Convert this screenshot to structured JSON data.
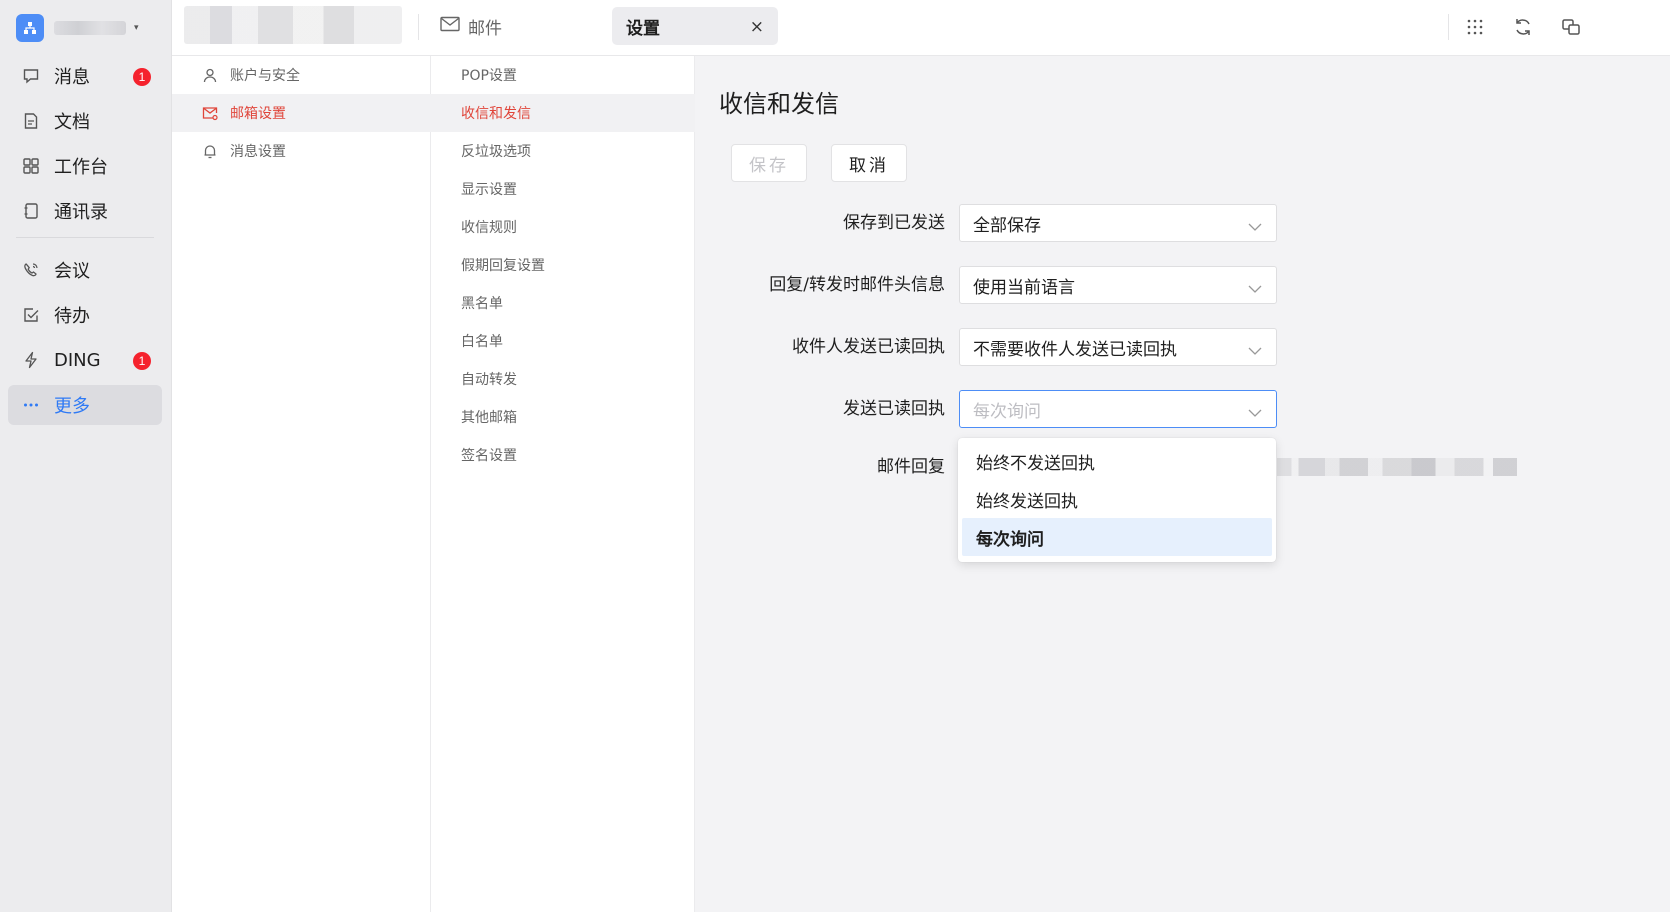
{
  "topbar": {
    "tabs": [
      {
        "label": "邮件",
        "icon": "mail-icon"
      },
      {
        "label": "设置",
        "icon": "",
        "active": true
      }
    ],
    "close_symbol": "×",
    "right_icons": [
      "apps-grid-icon",
      "refresh-icon",
      "window-switch-icon"
    ]
  },
  "sidebar": {
    "org_caret": "▾",
    "items": [
      {
        "label": "消息",
        "icon": "message-icon",
        "badge": "1"
      },
      {
        "label": "文档",
        "icon": "document-icon"
      },
      {
        "label": "工作台",
        "icon": "workbench-icon"
      },
      {
        "label": "通讯录",
        "icon": "contacts-icon"
      },
      {
        "label": "会议",
        "icon": "meeting-icon"
      },
      {
        "label": "待办",
        "icon": "todo-icon"
      },
      {
        "label": "DING",
        "icon": "ding-icon",
        "badge": "1"
      },
      {
        "label": "更多",
        "icon": "more-icon",
        "active": true
      }
    ]
  },
  "settings_categories": [
    {
      "label": "账户与安全",
      "icon": "user-icon"
    },
    {
      "label": "邮箱设置",
      "icon": "mail-settings-icon",
      "active": true
    },
    {
      "label": "消息设置",
      "icon": "bell-icon"
    }
  ],
  "mail_settings_menu": [
    {
      "label": "POP设置"
    },
    {
      "label": "收信和发信",
      "active": true
    },
    {
      "label": "反垃圾选项"
    },
    {
      "label": "显示设置"
    },
    {
      "label": "收信规则"
    },
    {
      "label": "假期回复设置"
    },
    {
      "label": "黑名单"
    },
    {
      "label": "白名单"
    },
    {
      "label": "自动转发"
    },
    {
      "label": "其他邮箱"
    },
    {
      "label": "签名设置"
    }
  ],
  "main": {
    "title": "收信和发信",
    "buttons": {
      "save": "保存",
      "cancel": "取消"
    },
    "form": [
      {
        "label": "保存到已发送",
        "value": "全部保存"
      },
      {
        "label": "回复/转发时邮件头信息",
        "value": "使用当前语言"
      },
      {
        "label": "收件人发送已读回执",
        "value": "不需要收件人发送已读回执"
      },
      {
        "label": "发送已读回执",
        "placeholder": "每次询问",
        "focused": true
      },
      {
        "label": "邮件回复"
      }
    ],
    "dropdown": {
      "options": [
        "始终不发送回执",
        "始终发送回执",
        "每次询问"
      ],
      "selected": "每次询问"
    }
  },
  "colors": {
    "accent_blue": "#2f7af5",
    "active_red": "#e0453a",
    "badge_red": "#f5222d",
    "org_logo_blue": "#4d8df6"
  }
}
